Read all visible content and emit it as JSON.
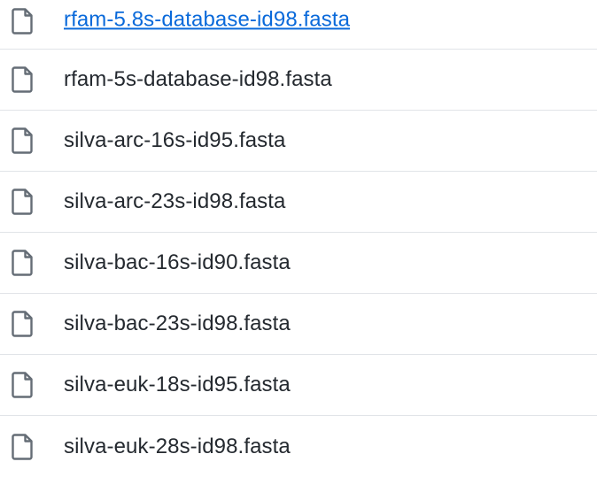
{
  "files": [
    {
      "name": "rfam-5.8s-database-id98.fasta",
      "icon": "file-icon"
    },
    {
      "name": "rfam-5s-database-id98.fasta",
      "icon": "file-icon"
    },
    {
      "name": "silva-arc-16s-id95.fasta",
      "icon": "file-icon"
    },
    {
      "name": "silva-arc-23s-id98.fasta",
      "icon": "file-icon"
    },
    {
      "name": "silva-bac-16s-id90.fasta",
      "icon": "file-icon"
    },
    {
      "name": "silva-bac-23s-id98.fasta",
      "icon": "file-icon"
    },
    {
      "name": "silva-euk-18s-id95.fasta",
      "icon": "file-icon"
    },
    {
      "name": "silva-euk-28s-id98.fasta",
      "icon": "file-icon"
    }
  ],
  "colors": {
    "text": "#24292f",
    "icon": "#656d76",
    "divider": "#e1e4e8"
  }
}
